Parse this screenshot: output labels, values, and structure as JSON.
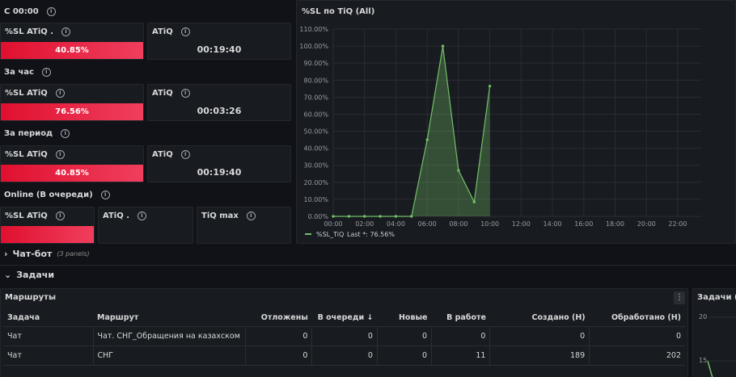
{
  "rows": {
    "since_midnight": "С 00:00",
    "per_hour": "За час",
    "per_period": "За период",
    "online": "Online (В очереди)"
  },
  "stats": {
    "r1_sl_title": "%SL ATiQ .",
    "r1_sl_value": "40.85%",
    "r1_atiq_title": "ATiQ",
    "r1_atiq_value": "00:19:40",
    "r2_sl_title": "%SL ATiQ",
    "r2_sl_value": "76.56%",
    "r2_atiq_title": "ATiQ",
    "r2_atiq_value": "00:03:26",
    "r3_sl_title": "%SL ATiQ",
    "r3_sl_value": "40.85%",
    "r3_atiq_title": "ATiQ",
    "r3_atiq_value": "00:19:40",
    "r4_sl_title": "%SL ATiQ",
    "r4_atiq_title": "ATiQ .",
    "r4_tiq_title": "TiQ max"
  },
  "sections": {
    "chatbot": "Чат-бот",
    "chatbot_panels": "(3 panels)",
    "tasks": "Задачи"
  },
  "colors": {
    "bar_red": "#e0102f",
    "series_green": "#73bf69",
    "background": "#111217"
  },
  "table": {
    "title": "Маршруты",
    "columns": [
      "Задача",
      "Маршрут",
      "Отложены",
      "В очереди ↓",
      "Новые",
      "В работе",
      "Создано (Н)",
      "Обработано (Н)"
    ],
    "rows": [
      [
        "Чат",
        "Чат. СНГ_Обращения на казахском",
        "0",
        "0",
        "0",
        "0",
        "0",
        "0"
      ],
      [
        "Чат",
        "СНГ",
        "0",
        "0",
        "0",
        "11",
        "189",
        "202"
      ]
    ]
  },
  "right_panel": {
    "title": "Задачи (All)",
    "tick_20": "20",
    "tick_15": "15"
  },
  "chart_data": {
    "type": "area",
    "title": "%SL по TiQ (All)",
    "x": [
      "00:00",
      "01:00",
      "02:00",
      "03:00",
      "04:00",
      "05:00",
      "06:00",
      "07:00",
      "08:00",
      "09:00",
      "10:00"
    ],
    "x_ticks": [
      "00:00",
      "02:00",
      "04:00",
      "06:00",
      "08:00",
      "10:00",
      "12:00",
      "14:00",
      "16:00",
      "18:00",
      "20:00",
      "22:00"
    ],
    "y_ticks": [
      "0.00%",
      "10.00%",
      "20.00%",
      "30.00%",
      "40.00%",
      "50.00%",
      "60.00%",
      "70.00%",
      "80.00%",
      "90.00%",
      "100.00%",
      "110.00%"
    ],
    "ylim": [
      0,
      110
    ],
    "xlim_hours": [
      0,
      23.5
    ],
    "series": [
      {
        "name": "%SL_TiQ",
        "values": [
          0,
          0,
          0,
          0,
          0,
          0,
          45,
          100,
          27,
          8.5,
          76.5
        ],
        "color": "#73bf69"
      }
    ],
    "legend": "%SL_TiQ",
    "legend_stat": "Last *: 76.56%",
    "legend_position": "bottom-left",
    "grid": true
  }
}
